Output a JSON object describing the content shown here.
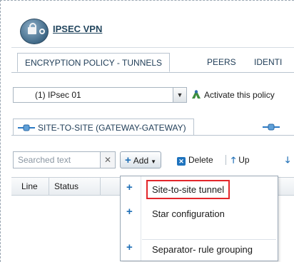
{
  "app": {
    "title": "IPSEC VPN"
  },
  "tabs": [
    {
      "label": "ENCRYPTION POLICY - TUNNELS",
      "active": true
    },
    {
      "label": "PEERS",
      "active": false
    },
    {
      "label": "IDENTI",
      "active": false
    }
  ],
  "policy": {
    "selected": "(1) IPsec 01",
    "activate_label": "Activate this policy"
  },
  "subtabs": [
    {
      "label": "SITE-TO-SITE (GATEWAY-GATEWAY)",
      "active": true
    }
  ],
  "toolbar": {
    "search_placeholder": "Searched text",
    "clear_label": "✕",
    "add_label": "Add",
    "delete_label": "Delete",
    "up_label": "Up"
  },
  "grid": {
    "columns": [
      "Line",
      "Status"
    ]
  },
  "add_menu": {
    "items": [
      {
        "label": "Site-to-site tunnel",
        "highlighted": true
      },
      {
        "label": "Star configuration",
        "highlighted": false
      },
      {
        "label": "Separator- rule grouping",
        "highlighted": false
      }
    ]
  },
  "colors": {
    "accent": "#1f6fb6",
    "highlight_border": "#e3262b",
    "title": "#24475f"
  }
}
